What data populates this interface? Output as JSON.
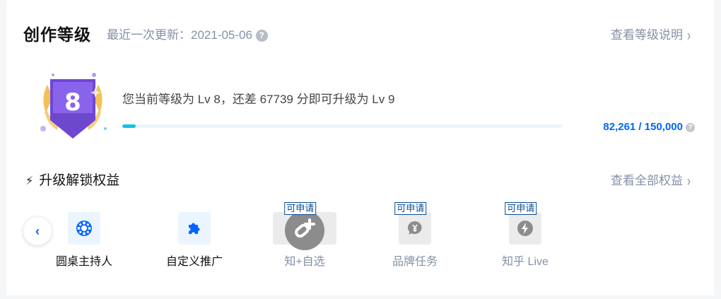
{
  "header": {
    "title": "创作等级",
    "updated": "最近一次更新：2021-05-06",
    "help_glyph": "?",
    "level_link": "查看等级说明",
    "chevron": "›"
  },
  "level": {
    "badge_number": "8",
    "text": "您当前等级为 Lv 8，还差 67739 分即可升级为 Lv 9",
    "score": "82,261 / 150,000",
    "progress_fraction": 0.03,
    "progress_color": "#14c1e6",
    "help_glyph": "?"
  },
  "rights": {
    "bolt_glyph": "⚡",
    "title": "升级解锁权益",
    "view_all": "查看全部权益",
    "chevron": "›",
    "prev_glyph": "‹",
    "items": [
      {
        "label": "圆桌主持人",
        "icon": "roundtable-icon",
        "state": "active"
      },
      {
        "label": "自定义推广",
        "icon": "puzzle-icon",
        "state": "active"
      },
      {
        "label": "知+自选",
        "icon": "zhiplus-icon",
        "state": "inactive",
        "tag": "可申请"
      },
      {
        "label": "品牌任务",
        "icon": "yen-chat-icon",
        "state": "inactive",
        "tag": "可申请"
      },
      {
        "label": "知乎 Live",
        "icon": "lightning-icon",
        "state": "inactive",
        "tag": "可申请"
      }
    ]
  },
  "colors": {
    "accent": "#0066ff",
    "muted": "#8590a6",
    "badge_purple": "#7a52e0",
    "badge_gold": "#f2c15a"
  }
}
